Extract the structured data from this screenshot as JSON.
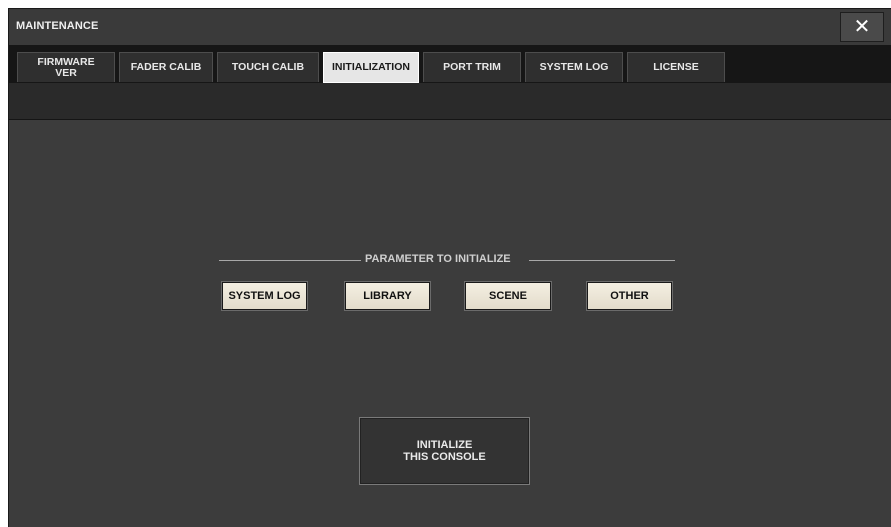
{
  "window": {
    "title": "MAINTENANCE",
    "close_glyph": "✕",
    "close_icon": "close-icon"
  },
  "tabs": [
    {
      "label": "FIRMWARE\nVER",
      "active": false
    },
    {
      "label": "FADER CALIB",
      "active": false
    },
    {
      "label": "TOUCH CALIB",
      "active": false
    },
    {
      "label": "INITIALIZATION",
      "active": true
    },
    {
      "label": "PORT TRIM",
      "active": false
    },
    {
      "label": "SYSTEM LOG",
      "active": false
    },
    {
      "label": "LICENSE",
      "active": false
    }
  ],
  "section": {
    "label": "PARAMETER TO INITIALIZE"
  },
  "parameters": [
    {
      "label": "SYSTEM LOG"
    },
    {
      "label": "LIBRARY"
    },
    {
      "label": "SCENE"
    },
    {
      "label": "OTHER"
    }
  ],
  "initialize_button": {
    "label": "INITIALIZE\nTHIS CONSOLE"
  },
  "colors": {
    "panel": "#3c3c3c",
    "tab_bar": "#161616",
    "active_tab": "#e6e6e6",
    "param_button": "#efe9da"
  }
}
